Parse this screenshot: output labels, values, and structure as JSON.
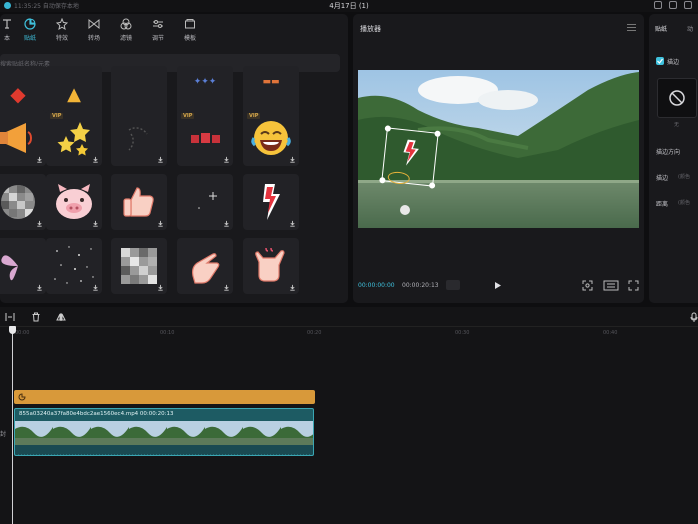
{
  "titlebar": {
    "status": "11:35:25 自动保存本地",
    "title": "4月17日 (1)"
  },
  "left_panel": {
    "tabs": [
      {
        "label": "本",
        "icon": "text-icon",
        "active": false
      },
      {
        "label": "贴纸",
        "icon": "sticker-icon",
        "active": true
      },
      {
        "label": "特效",
        "icon": "effects-icon",
        "active": false
      },
      {
        "label": "转场",
        "icon": "transition-icon",
        "active": false
      },
      {
        "label": "滤镜",
        "icon": "filter-icon",
        "active": false
      },
      {
        "label": "调节",
        "icon": "adjust-icon",
        "active": false
      },
      {
        "label": "模板",
        "icon": "template-icon",
        "active": false
      }
    ],
    "search_placeholder": "搜索贴纸名称/元素",
    "vip_badge": "VIP"
  },
  "player": {
    "title": "播放器",
    "current_time": "00:00:00:00",
    "total_time": "00:00:20:13"
  },
  "right_panel": {
    "tabs": [
      "贴纸",
      "动"
    ],
    "checkbox_label": "描边",
    "none_label": "无",
    "rows": [
      {
        "label": "描边方向",
        "value": ""
      },
      {
        "label": "描边",
        "value": "(颜色"
      },
      {
        "label": "距离",
        "value": "(颜色"
      }
    ]
  },
  "timeline": {
    "ruler": [
      "00:00",
      "00:10",
      "00:20",
      "00:30",
      "00:40"
    ],
    "track_label": "封",
    "video_clip_label": "855a03240a37fa80e4bdc2ae1560ec4.mp4   00:00:20:13"
  }
}
